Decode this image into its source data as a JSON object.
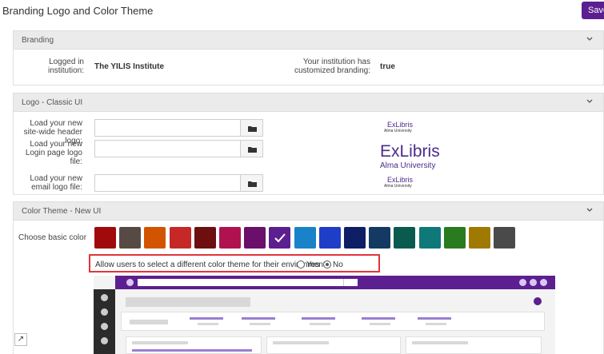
{
  "page": {
    "title": "Branding Logo and Color Theme",
    "save_label": "Save"
  },
  "branding": {
    "header": "Branding",
    "logged_in_label": "Logged in institution:",
    "logged_in_value": "The YILIS Institute",
    "customized_label": "Your institution has customized branding:",
    "customized_value": "true"
  },
  "logo": {
    "header": "Logo - Classic UI",
    "header_logo_label": "Load your new site-wide header logo:",
    "login_logo_label": "Load your new Login page logo file:",
    "email_logo_label": "Load your new email logo file:",
    "logo_brand": "ExLibris",
    "logo_sub": "Alma University"
  },
  "color_theme": {
    "header": "Color Theme - New UI",
    "choose_label": "Choose basic color",
    "swatches": [
      "#a10a0a",
      "#574a44",
      "#d35400",
      "#c62828",
      "#6d0f0f",
      "#b0124f",
      "#6a0f6a",
      "#5c1f8f",
      "#1a82c8",
      "#1e3ec8",
      "#0f1f66",
      "#123a63",
      "#0a5a4f",
      "#0f7878",
      "#2a7a1f",
      "#a07a00",
      "#4a4a4a"
    ],
    "selected_index": 7,
    "allow_label": "Allow users to select a different color theme for their environment:",
    "yes_label": "Yes",
    "no_label": "No",
    "allow_value": "No"
  },
  "icons": {
    "chevron": "chevron-down-icon",
    "folder": "folder-icon",
    "check": "check-icon",
    "expand": "expand-icon"
  }
}
